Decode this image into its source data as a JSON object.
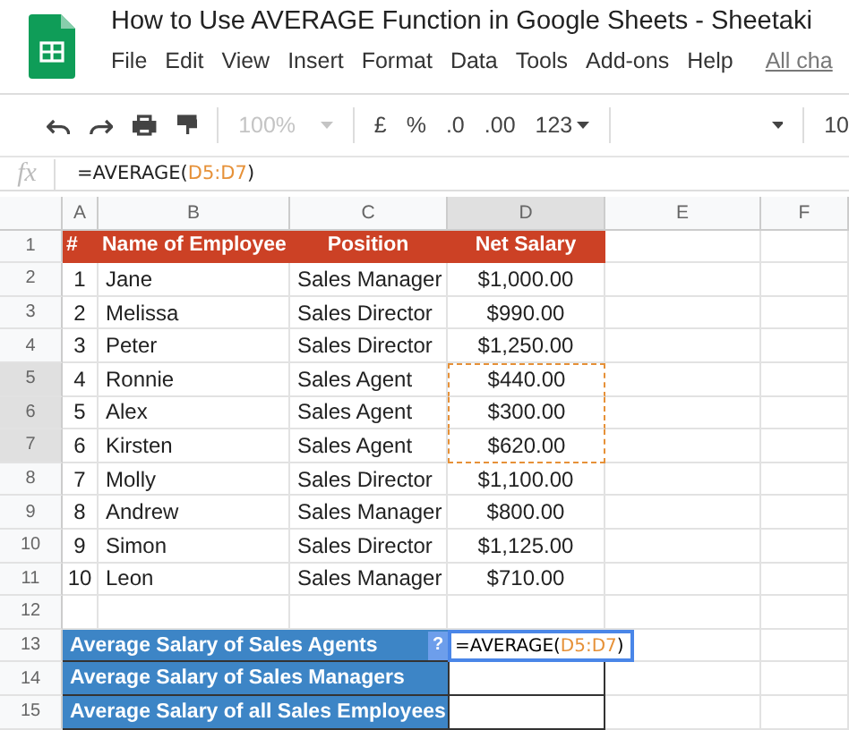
{
  "app": {
    "title": "How to Use AVERAGE Function in Google Sheets - Sheetaki",
    "menu": [
      "File",
      "Edit",
      "View",
      "Insert",
      "Format",
      "Data",
      "Tools",
      "Add-ons",
      "Help"
    ],
    "menu_link": "All cha"
  },
  "toolbar": {
    "zoom": "100%",
    "zoom_disabled": true,
    "currency": "£",
    "percent": "%",
    "decrease_decimals": ".0",
    "increase_decimals": ".00",
    "number_format": "123",
    "font_size": "10"
  },
  "formula_bar": {
    "fx": "fx",
    "prefix": "=AVERAGE(",
    "range": "D5:D7",
    "suffix": ")"
  },
  "sheet": {
    "columns": [
      {
        "label": "A",
        "selected": false
      },
      {
        "label": "B",
        "selected": false
      },
      {
        "label": "C",
        "selected": false
      },
      {
        "label": "D",
        "selected": true
      },
      {
        "label": "E",
        "selected": false
      },
      {
        "label": "F",
        "selected": false
      }
    ],
    "rows": [
      {
        "number": "1",
        "kind": "header",
        "selected": false,
        "cells": [
          "#",
          "Name of Employee",
          "Position",
          "Net Salary"
        ]
      },
      {
        "number": "2",
        "kind": "data",
        "selected": false,
        "cells": [
          "1",
          "Jane",
          "Sales Manager",
          "$1,000.00"
        ]
      },
      {
        "number": "3",
        "kind": "data",
        "selected": false,
        "cells": [
          "2",
          "Melissa",
          "Sales Director",
          "$990.00"
        ]
      },
      {
        "number": "4",
        "kind": "data",
        "selected": false,
        "cells": [
          "3",
          "Peter",
          "Sales Director",
          "$1,250.00"
        ]
      },
      {
        "number": "5",
        "kind": "data",
        "selected": true,
        "cells": [
          "4",
          "Ronnie",
          "Sales Agent",
          "$440.00"
        ]
      },
      {
        "number": "6",
        "kind": "data",
        "selected": true,
        "cells": [
          "5",
          "Alex",
          "Sales Agent",
          "$300.00"
        ]
      },
      {
        "number": "7",
        "kind": "data",
        "selected": true,
        "cells": [
          "6",
          "Kirsten",
          "Sales Agent",
          "$620.00"
        ]
      },
      {
        "number": "8",
        "kind": "data",
        "selected": false,
        "cells": [
          "7",
          "Molly",
          "Sales Director",
          "$1,100.00"
        ]
      },
      {
        "number": "9",
        "kind": "data",
        "selected": false,
        "cells": [
          "8",
          "Andrew",
          "Sales Manager",
          "$800.00"
        ]
      },
      {
        "number": "10",
        "kind": "data",
        "selected": false,
        "cells": [
          "9",
          "Simon",
          "Sales Director",
          "$1,125.00"
        ]
      },
      {
        "number": "11",
        "kind": "data",
        "selected": false,
        "cells": [
          "10",
          "Leon",
          "Sales Manager",
          "$710.00"
        ]
      },
      {
        "number": "12",
        "kind": "blank",
        "selected": false
      },
      {
        "number": "13",
        "kind": "summary",
        "selected": false,
        "label": "Average Salary of Sales Agents",
        "editing": true,
        "help": "?",
        "prefix": "=AVERAGE(",
        "range": "D5:D7",
        "suffix": ")"
      },
      {
        "number": "14",
        "kind": "summary",
        "selected": false,
        "label": "Average Salary of Sales Managers",
        "editing": false
      },
      {
        "number": "15",
        "kind": "summary",
        "selected": false,
        "label": "Average Salary of all Sales Employees",
        "editing": false
      }
    ]
  }
}
